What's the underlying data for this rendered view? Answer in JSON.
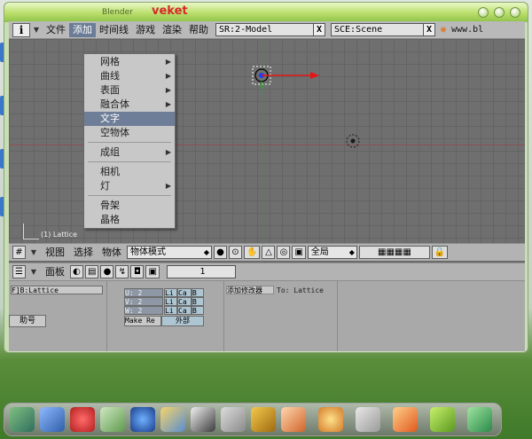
{
  "window": {
    "title_small": "Blender",
    "title_main": "veket"
  },
  "topbar": {
    "info_button": "i",
    "menus": [
      "文件",
      "添加",
      "时间线",
      "游戏",
      "渲染",
      "帮助"
    ],
    "screen_field": "SR:2-Model",
    "scene_field": "SCE:Scene",
    "url_text": "www.bl"
  },
  "add_menu": {
    "items": [
      {
        "label": "网格",
        "submenu": true
      },
      {
        "label": "曲线",
        "submenu": true
      },
      {
        "label": "表面",
        "submenu": true
      },
      {
        "label": "融合体",
        "submenu": true
      },
      {
        "label": "文字",
        "submenu": false,
        "highlighted": true
      },
      {
        "label": "空物体",
        "submenu": false
      },
      {
        "label": "成组",
        "submenu": true
      },
      {
        "label": "相机",
        "submenu": false
      },
      {
        "label": "灯",
        "submenu": true
      },
      {
        "label": "骨架",
        "submenu": false
      },
      {
        "label": "晶格",
        "submenu": false
      }
    ]
  },
  "viewport": {
    "object_label": "(1) Lattice"
  },
  "view_toolbar": {
    "view_menu": "视图",
    "select_menu": "选择",
    "object_menu": "物体",
    "mode_field": "物体模式",
    "global_field": "全局"
  },
  "buttons_header": {
    "panels_label": "面板",
    "frame_value": "1"
  },
  "buttons": {
    "object_field": "F]B:Lattice",
    "help_button": "助号",
    "u_field": "U: 2",
    "v_field": "V: 2",
    "w_field": "W: 2",
    "li_label": "Li",
    "ca_label": "Ca",
    "b_label": "B",
    "make_regular_button": "Make Re",
    "outside_button": "外部",
    "add_modifier_label": "添加修改器",
    "to_label": "To: Lattice"
  },
  "colors": {
    "title_accent": "#d62929",
    "menu_highlight": "#6e7e98",
    "viewport_bg": "#6f6f6f",
    "titlebar_green": "#b9de6a"
  }
}
